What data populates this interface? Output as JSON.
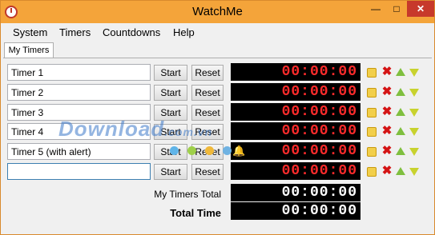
{
  "window": {
    "title": "WatchMe",
    "title_bar_color": "#f4a43a",
    "controls": {
      "minimize_icon": "minimize-icon",
      "maximize_icon": "maximize-icon",
      "close_icon": "close-icon"
    }
  },
  "menu": {
    "items": [
      "System",
      "Timers",
      "Countdowns",
      "Help"
    ]
  },
  "tabs": [
    {
      "label": "My Timers",
      "active": true
    }
  ],
  "timers": [
    {
      "name": "Timer 1",
      "start_label": "Start",
      "reset_label": "Reset",
      "time": "00:00:00"
    },
    {
      "name": "Timer 2",
      "start_label": "Start",
      "reset_label": "Reset",
      "time": "00:00:00"
    },
    {
      "name": "Timer 3",
      "start_label": "Start",
      "reset_label": "Reset",
      "time": "00:00:00"
    },
    {
      "name": "Timer 4",
      "start_label": "Start",
      "reset_label": "Reset",
      "time": "00:00:00"
    },
    {
      "name": "Timer 5 (with alert)",
      "start_label": "Start",
      "reset_label": "Reset",
      "time": "00:00:00",
      "alert": true
    },
    {
      "name": "",
      "start_label": "Start",
      "reset_label": "Reset",
      "time": "00:00:00"
    }
  ],
  "totals": {
    "my_timers_total_label": "My Timers Total",
    "my_timers_total_value": "00:00:00",
    "total_time_label": "Total Time",
    "total_time_value": "00:00:00"
  },
  "colors": {
    "timer_digits": "#ff2b2b",
    "total_digits": "#ffffff",
    "display_background": "#000000"
  },
  "watermark": {
    "text": "Download",
    "tld": ".com.vn"
  }
}
